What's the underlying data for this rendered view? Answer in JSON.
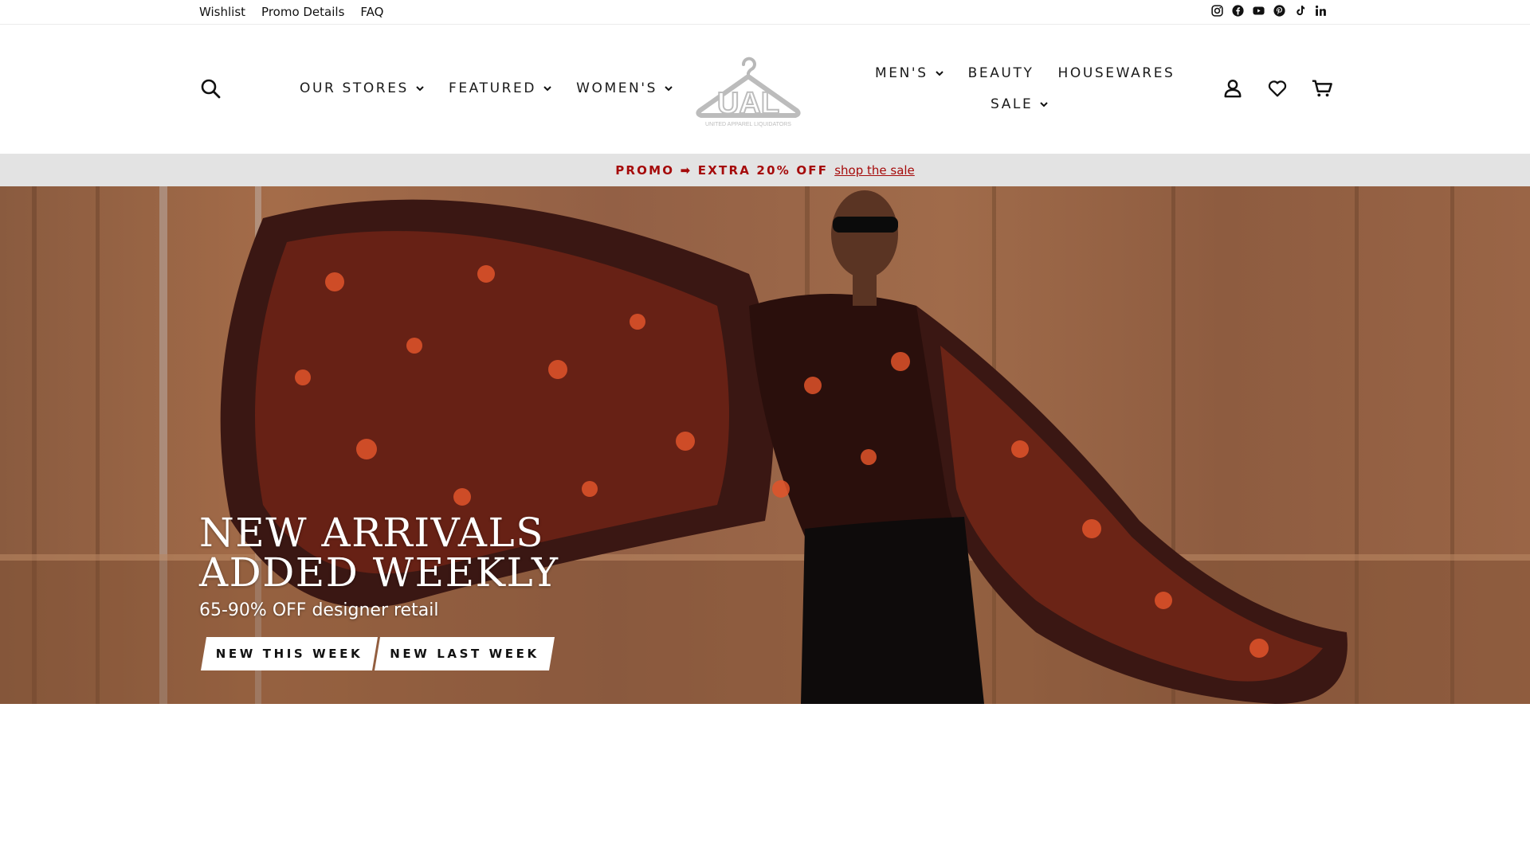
{
  "utility": {
    "links": [
      "Wishlist",
      "Promo Details",
      "FAQ"
    ],
    "social_icons": [
      "instagram-icon",
      "facebook-icon",
      "youtube-icon",
      "pinterest-icon",
      "tiktok-icon",
      "linkedin-icon"
    ]
  },
  "nav": {
    "left": [
      {
        "label": "OUR STORES"
      },
      {
        "label": "FEATURED"
      },
      {
        "label": "WOMEN'S"
      }
    ],
    "right_top": [
      {
        "label": "MEN'S"
      },
      {
        "label": "BEAUTY"
      },
      {
        "label": "HOUSEWARES"
      }
    ],
    "right_bottom": [
      {
        "label": "SALE"
      }
    ]
  },
  "logo": {
    "text": "UAL",
    "subtext": "UNITED APPAREL LIQUIDATORS"
  },
  "header_icons": [
    "search-icon",
    "account-icon",
    "wishlist-heart-icon",
    "cart-icon"
  ],
  "promo": {
    "text": "PROMO ➡ EXTRA 20% OFF",
    "link": "shop the sale"
  },
  "hero": {
    "headline_1": "NEW ARRIVALS",
    "headline_2": "ADDED WEEKLY",
    "subheadline": "65-90% OFF designer retail",
    "buttons": [
      "NEW THIS WEEK",
      "NEW LAST WEEK"
    ]
  },
  "colors": {
    "promo_red": "#a50a0a",
    "promo_bg": "#e3e3e3",
    "text_dark": "#111111"
  }
}
